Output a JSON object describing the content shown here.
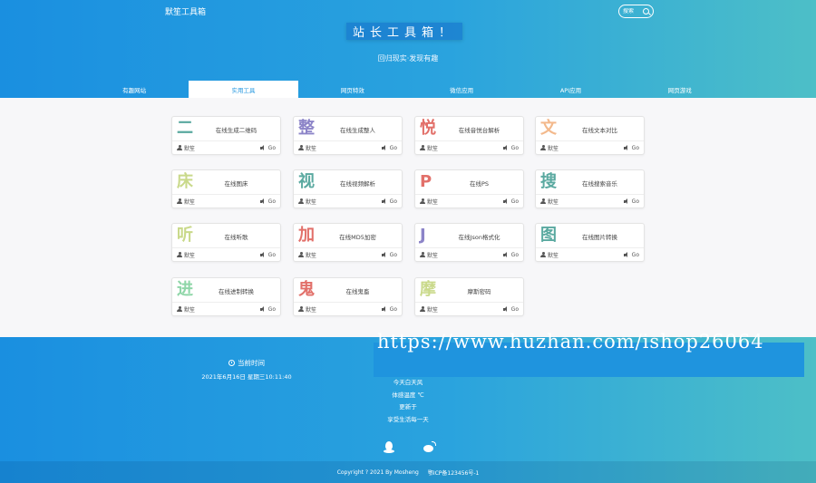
{
  "header": {
    "brand": "默笙工具箱",
    "search_placeholder": "搜索",
    "title": "站长工具箱！",
    "subtitle": "回归现实·发现有趣"
  },
  "tabs": [
    {
      "label": "有趣网站",
      "active": false
    },
    {
      "label": "实用工具",
      "active": true
    },
    {
      "label": "网页特效",
      "active": false
    },
    {
      "label": "微信应用",
      "active": false
    },
    {
      "label": "API应用",
      "active": false
    },
    {
      "label": "网页游戏",
      "active": false
    }
  ],
  "cards": [
    {
      "glyph": "二",
      "color": "#5aa9a0",
      "title": "在线生成二维码",
      "author": "默笙",
      "go": "Go"
    },
    {
      "glyph": "整",
      "color": "#8c84c8",
      "title": "在线生成整人",
      "author": "默笙",
      "go": "Go"
    },
    {
      "glyph": "悦",
      "color": "#e2706a",
      "title": "在线音悦台解析",
      "author": "默笙",
      "go": "Go"
    },
    {
      "glyph": "文",
      "color": "#f3b98c",
      "title": "在线文本对比",
      "author": "默笙",
      "go": "Go"
    },
    {
      "glyph": "床",
      "color": "#c9d98a",
      "title": "在线图床",
      "author": "默笙",
      "go": "Go"
    },
    {
      "glyph": "视",
      "color": "#5aa9a0",
      "title": "在线视频解析",
      "author": "默笙",
      "go": "Go"
    },
    {
      "glyph": "P",
      "color": "#e2706a",
      "title": "在线PS",
      "author": "默笙",
      "go": "Go"
    },
    {
      "glyph": "搜",
      "color": "#5aa9a0",
      "title": "在线搜索音乐",
      "author": "默笙",
      "go": "Go"
    },
    {
      "glyph": "听",
      "color": "#c9d98a",
      "title": "在线听歌",
      "author": "默笙",
      "go": "Go"
    },
    {
      "glyph": "加",
      "color": "#e2706a",
      "title": "在线MD5加密",
      "author": "默笙",
      "go": "Go"
    },
    {
      "glyph": "J",
      "color": "#8c84c8",
      "title": "在线Json格式化",
      "author": "默笙",
      "go": "Go"
    },
    {
      "glyph": "图",
      "color": "#5aa9a0",
      "title": "在线图片转换",
      "author": "默笙",
      "go": "Go"
    },
    {
      "glyph": "进",
      "color": "#8fd6a8",
      "title": "在线进制转换",
      "author": "默笙",
      "go": "Go"
    },
    {
      "glyph": "鬼",
      "color": "#e2706a",
      "title": "在线鬼畜",
      "author": "默笙",
      "go": "Go"
    },
    {
      "glyph": "摩",
      "color": "#c9d98a",
      "title": "摩斯密码",
      "author": "默笙",
      "go": "Go"
    }
  ],
  "footer": {
    "time_title": "当前时间",
    "time_value": "2021年6月16日 星期三10:11:40",
    "watermark": "https://www.huzhan.com/ishop26064",
    "weather_lines": [
      "今天白天风",
      "体感温度 ℃",
      "更新于",
      "享受生活每一天"
    ],
    "copyright": "Copyright ? 2021 By Mosheng",
    "icp": "鄂ICP备123456号-1"
  }
}
